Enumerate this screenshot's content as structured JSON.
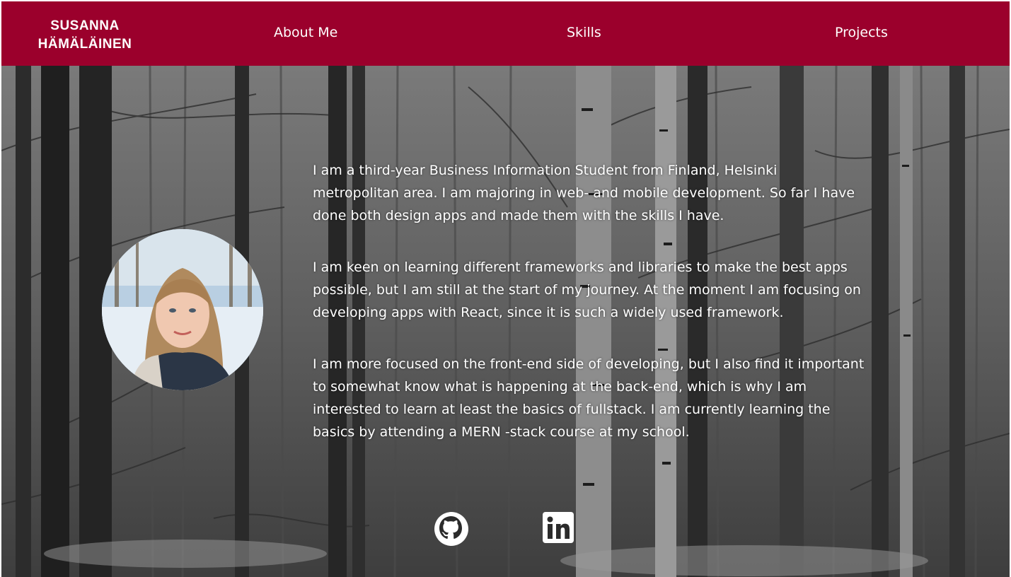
{
  "brand": {
    "name_line1": "SUSANNA",
    "name_line2": "HÄMÄLÄINEN",
    "color": "#9b002c"
  },
  "nav": {
    "items": [
      {
        "label": "About Me"
      },
      {
        "label": "Skills"
      },
      {
        "label": "Projects"
      }
    ]
  },
  "about": {
    "paragraphs": [
      "I am a third-year Business Information Student from Finland, Helsinki metropolitan area. I am majoring in web- and mobile development. So far I have done both design apps and made them with the skills I have.",
      "I am keen on learning different frameworks and libraries to make the best apps possible, but I am still at the start of my journey. At the moment I am focusing on developing apps with React, since it is such a widely used framework.",
      "I am more focused on the front-end side of developing, but I also find it important to somewhat know what is happening at the back-end, which is why I am interested to learn at least the basics of fullstack. I am currently learning the basics by attending a MERN -stack course at my school."
    ]
  },
  "social": {
    "github_icon": "github-icon",
    "linkedin_icon": "linkedin-icon"
  }
}
